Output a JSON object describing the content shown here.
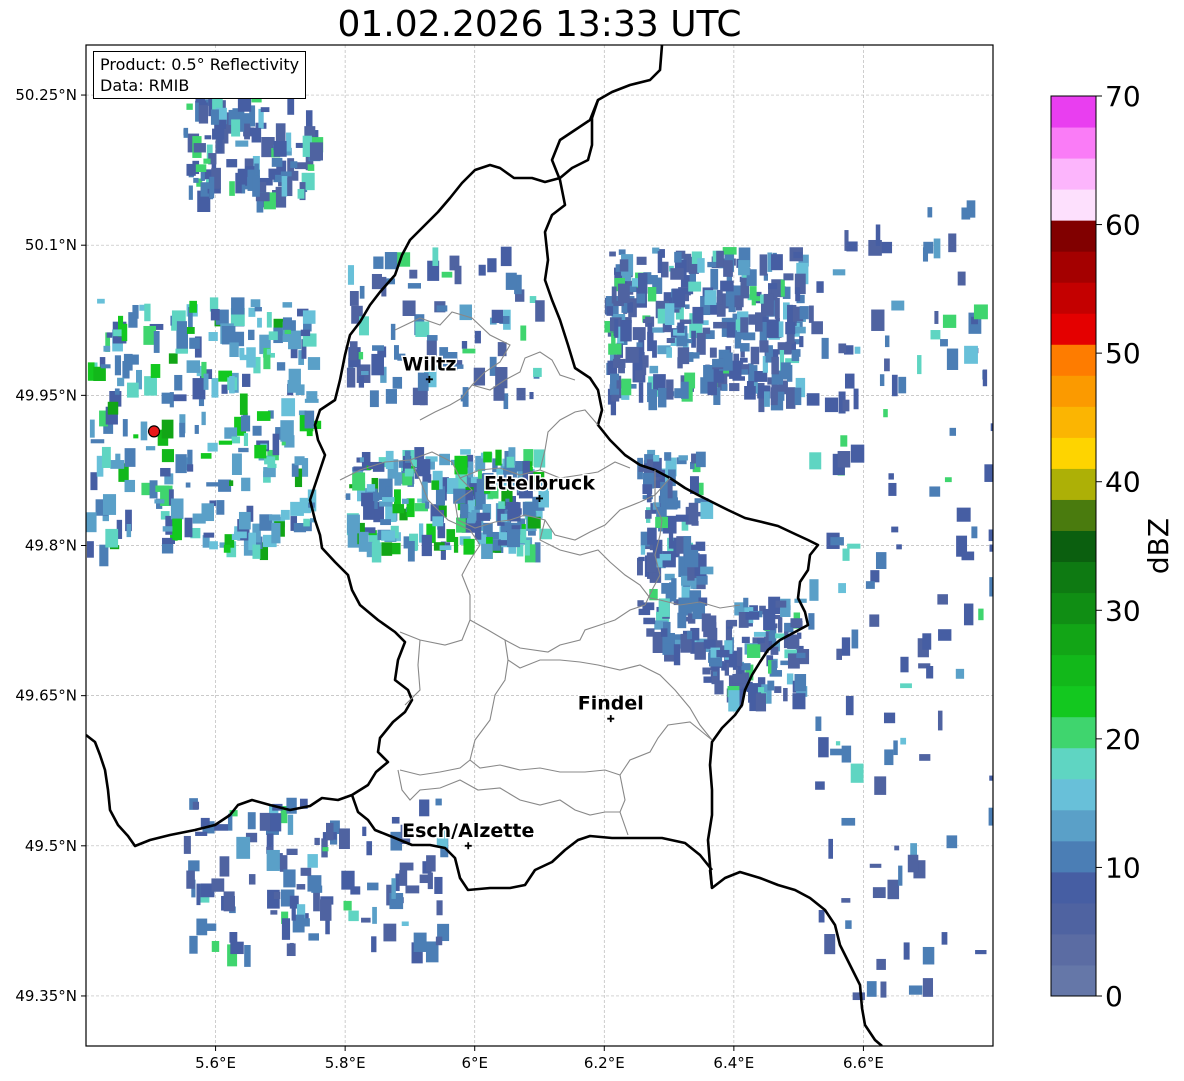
{
  "title": "01.02.2026 13:33 UTC",
  "info": {
    "product": "Product: 0.5° Reflectivity",
    "data": "Data: RMIB"
  },
  "map": {
    "lon_range": [
      5.4,
      6.8
    ],
    "lat_range": [
      49.3,
      50.3
    ],
    "grid": true,
    "lat_ticks": [
      {
        "value": 50.25,
        "label": "50.25°N"
      },
      {
        "value": 50.1,
        "label": "50.1°N"
      },
      {
        "value": 49.95,
        "label": "49.95°N"
      },
      {
        "value": 49.8,
        "label": "49.8°N"
      },
      {
        "value": 49.65,
        "label": "49.65°N"
      },
      {
        "value": 49.5,
        "label": "49.5°N"
      },
      {
        "value": 49.35,
        "label": "49.35°N"
      }
    ],
    "lon_ticks": [
      {
        "value": 5.6,
        "label": "5.6°E"
      },
      {
        "value": 5.8,
        "label": "5.8°E"
      },
      {
        "value": 6.0,
        "label": "6°E"
      },
      {
        "value": 6.2,
        "label": "6.2°E"
      },
      {
        "value": 6.4,
        "label": "6.4°E"
      },
      {
        "value": 6.6,
        "label": "6.6°E"
      }
    ],
    "cities": [
      {
        "name": "Wiltz",
        "lon": 5.93,
        "lat": 49.966
      },
      {
        "name": "Ettelbruck",
        "lon": 6.1,
        "lat": 49.847
      },
      {
        "name": "Findel",
        "lon": 6.21,
        "lat": 49.627
      },
      {
        "name": "Esch/Alzette",
        "lon": 5.99,
        "lat": 49.5
      }
    ],
    "radar_site": {
      "lon": 5.505,
      "lat": 49.914,
      "color": "#e8191a"
    },
    "country_border_color": "#000000",
    "canton_border_color": "#888888"
  },
  "colorbar": {
    "label": "dBZ",
    "min": 0,
    "max": 70,
    "ticks": [
      "0",
      "10",
      "20",
      "30",
      "40",
      "50",
      "60",
      "70"
    ],
    "colors": [
      "#6577a8",
      "#5b6ca3",
      "#4f63a1",
      "#465ea3",
      "#4b7eb5",
      "#5aa0c8",
      "#68c0d9",
      "#5fd5c2",
      "#3fd56e",
      "#13c81f",
      "#12b81a",
      "#12a516",
      "#108e14",
      "#0e7a12",
      "#0b5f0f",
      "#4a7b0e",
      "#adb006",
      "#fed400",
      "#fbb502",
      "#fb9a00",
      "#fe7c00",
      "#e40000",
      "#c40000",
      "#a40000",
      "#810000",
      "#fde0fd",
      "#fcb5fc",
      "#fa7cf7",
      "#e93ef0"
    ]
  },
  "precip_areas": [
    {
      "lon": [
        5.8,
        6.1
      ],
      "lat": [
        49.8,
        49.9
      ],
      "n": 240,
      "intensity": "moderate"
    },
    {
      "lon": [
        5.4,
        5.75
      ],
      "lat": [
        49.8,
        50.05
      ],
      "n": 260,
      "intensity": "moderate"
    },
    {
      "lon": [
        5.55,
        5.75
      ],
      "lat": [
        50.15,
        50.25
      ],
      "n": 120,
      "intensity": "light"
    },
    {
      "lon": [
        6.2,
        6.5
      ],
      "lat": [
        49.95,
        50.1
      ],
      "n": 320,
      "intensity": "light"
    },
    {
      "lon": [
        6.25,
        6.35
      ],
      "lat": [
        49.7,
        49.9
      ],
      "n": 140,
      "intensity": "light"
    },
    {
      "lon": [
        6.35,
        6.5
      ],
      "lat": [
        49.65,
        49.75
      ],
      "n": 120,
      "intensity": "light"
    },
    {
      "lon": [
        6.5,
        6.8
      ],
      "lat": [
        49.35,
        50.15
      ],
      "n": 140,
      "intensity": "light"
    },
    {
      "lon": [
        5.55,
        5.95
      ],
      "lat": [
        49.4,
        49.55
      ],
      "n": 120,
      "intensity": "light"
    },
    {
      "lon": [
        5.8,
        6.1
      ],
      "lat": [
        49.95,
        50.1
      ],
      "n": 80,
      "intensity": "light"
    }
  ]
}
